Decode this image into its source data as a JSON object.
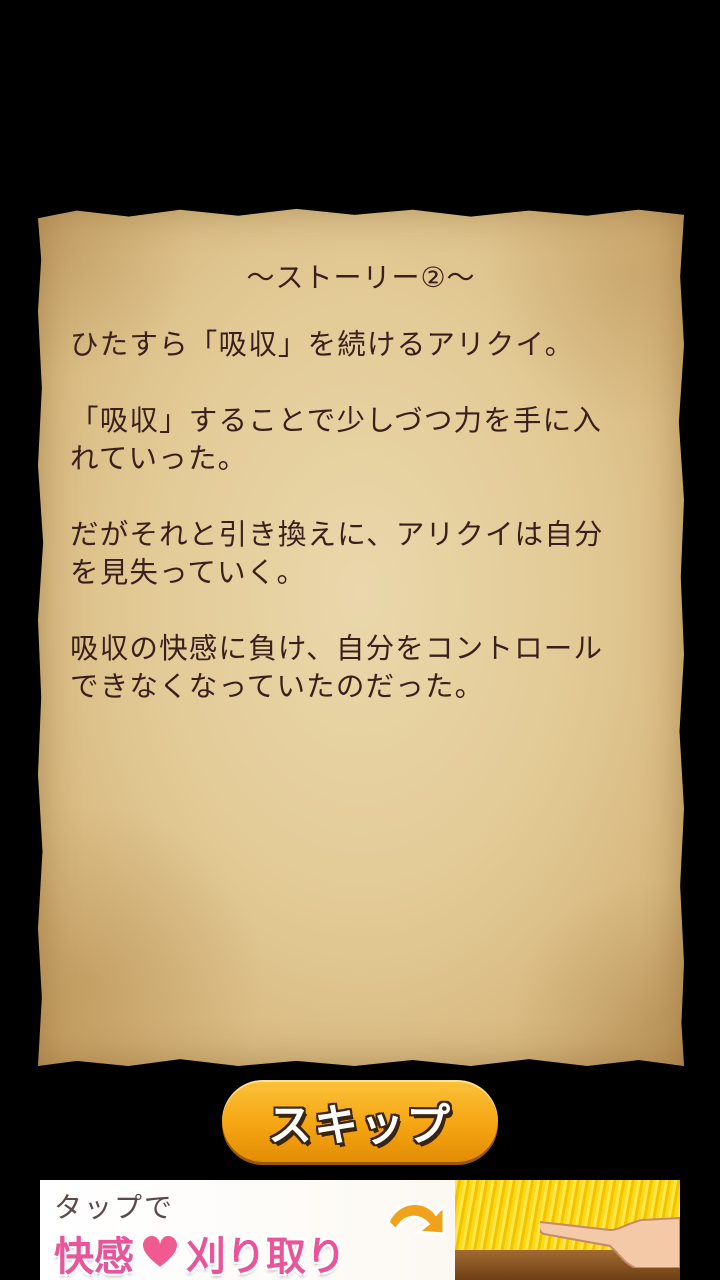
{
  "story": {
    "title": "～ストーリー②～",
    "paragraphs": [
      "ひたすら「吸収」を続けるアリクイ。",
      "「吸収」することで少しづつ力を手に入\nれていった。",
      "だがそれと引き換えに、アリクイは自分\nを見失っていく。",
      "吸収の快感に負け、自分をコントロール\nできなくなっていたのだった。"
    ]
  },
  "skip_button": {
    "label": "スキップ"
  },
  "ad": {
    "tagline": "タップで",
    "headline_left": "快感",
    "headline_right": "刈り取り",
    "icons": [
      "heart-icon",
      "arrow-icon",
      "hand-icon"
    ]
  }
}
